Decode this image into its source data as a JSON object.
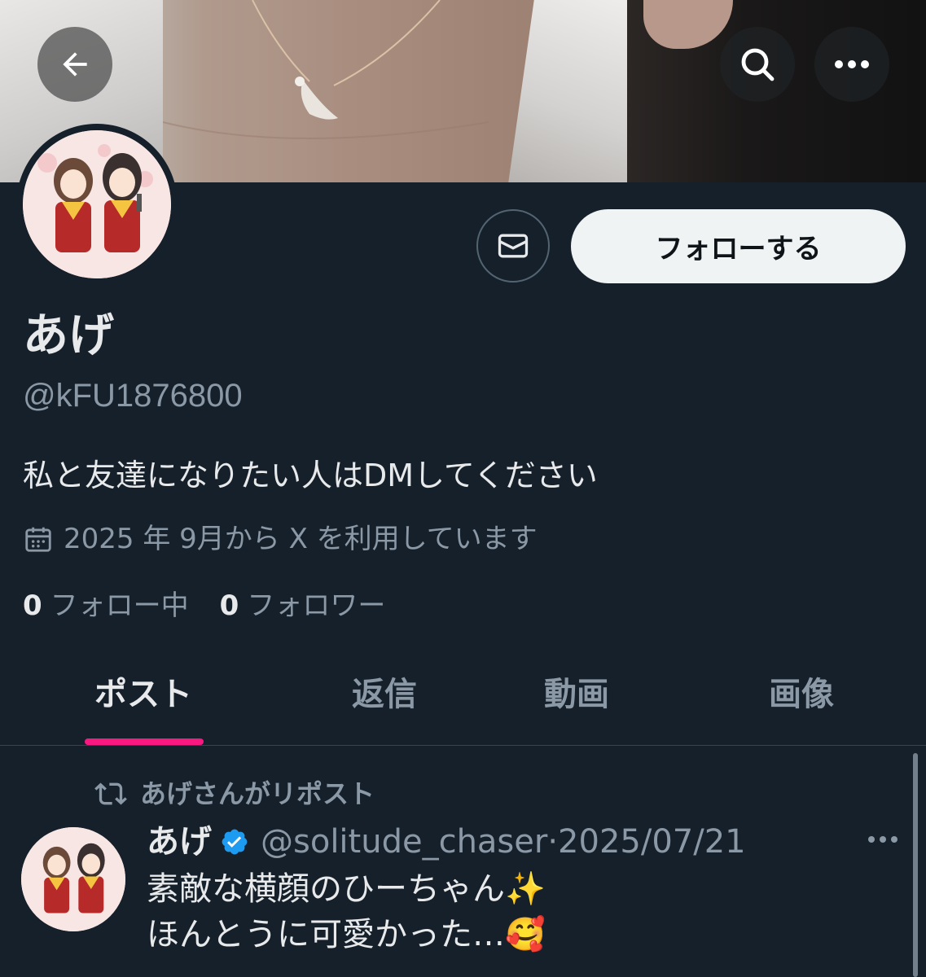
{
  "profile": {
    "display_name": "あげ",
    "handle": "@kFU1876800",
    "bio": "私と友達になりたい人はDMしてください",
    "joined": "2025 年 9月から X を利用しています",
    "following_count": "0",
    "following_label": "フォロー中",
    "followers_count": "0",
    "followers_label": "フォロワー"
  },
  "actions": {
    "follow_label": "フォローする"
  },
  "tabs": [
    {
      "label": "ポスト",
      "active": true
    },
    {
      "label": "返信",
      "active": false
    },
    {
      "label": "動画",
      "active": false
    },
    {
      "label": "画像",
      "active": false
    }
  ],
  "post": {
    "repost_label": "あげさんがリポスト",
    "author": "あげ",
    "handle": "@solitude_chaser",
    "separator": "·",
    "date": "2025/07/21",
    "line1": "素敵な横顔のひーちゃん✨",
    "line2": "ほんとうに可愛かった…🥰"
  },
  "icons": {
    "back": "arrow-left-icon",
    "search": "search-icon",
    "more": "more-horizontal-icon",
    "dm": "envelope-icon",
    "calendar": "calendar-icon",
    "repost": "repost-icon",
    "verified": "verified-badge-icon"
  },
  "colors": {
    "background": "#15202b",
    "accent_tab": "#f91880",
    "verified": "#1d9bf0",
    "secondary_text": "#8b98a5"
  }
}
